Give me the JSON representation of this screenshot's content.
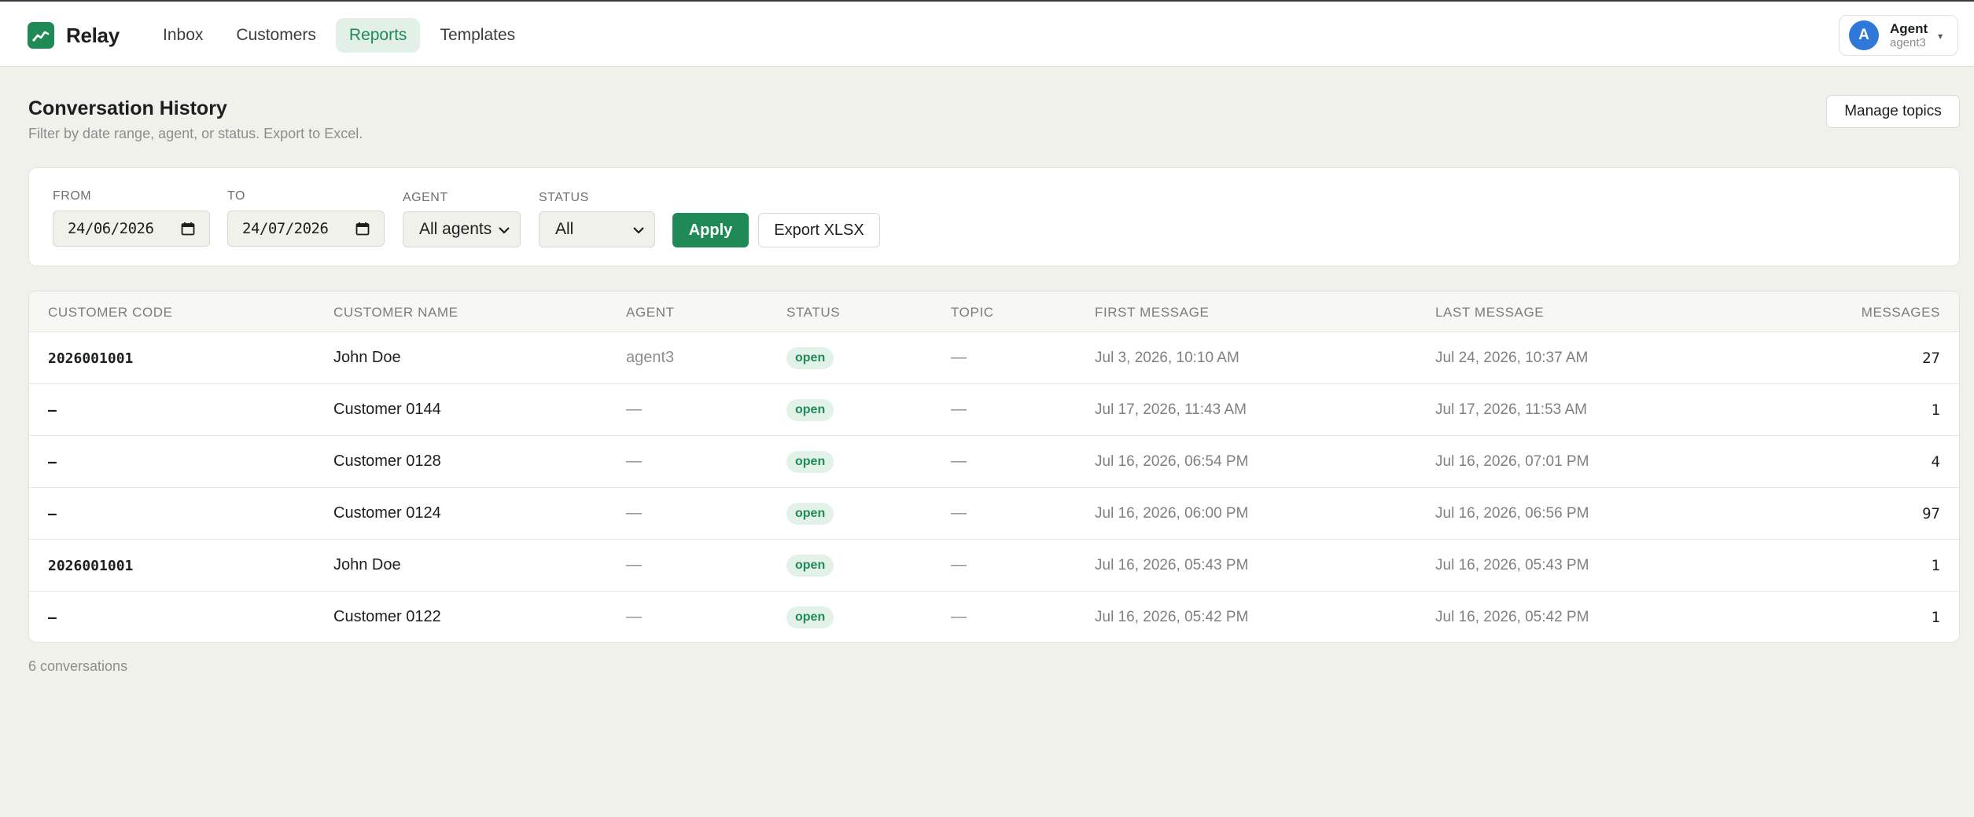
{
  "app": {
    "name": "Relay",
    "nav": [
      {
        "label": "Inbox",
        "active": false
      },
      {
        "label": "Customers",
        "active": false
      },
      {
        "label": "Reports",
        "active": true
      },
      {
        "label": "Templates",
        "active": false
      }
    ],
    "user": {
      "initial": "A",
      "name": "Agent",
      "username": "agent3"
    }
  },
  "page": {
    "title": "Conversation History",
    "subtitle": "Filter by date range, agent, or status. Export to Excel.",
    "manage_topics_label": "Manage topics"
  },
  "filters": {
    "from_label": "FROM",
    "from_value": "24/06/2026",
    "to_label": "TO",
    "to_value": "24/07/2026",
    "agent_label": "AGENT",
    "agent_value": "All agents",
    "status_label": "STATUS",
    "status_value": "All",
    "apply_label": "Apply",
    "export_label": "Export XLSX"
  },
  "table": {
    "headers": {
      "code": "CUSTOMER CODE",
      "name": "CUSTOMER NAME",
      "agent": "AGENT",
      "status": "STATUS",
      "topic": "TOPIC",
      "first": "FIRST MESSAGE",
      "last": "LAST MESSAGE",
      "messages": "MESSAGES"
    },
    "rows": [
      {
        "code": "2026001001",
        "name": "John Doe",
        "agent": "agent3",
        "status": "open",
        "topic": "—",
        "first": "Jul 3, 2026, 10:10 AM",
        "last": "Jul 24, 2026, 10:37 AM",
        "messages": "27"
      },
      {
        "code": "–",
        "name": "Customer 0144",
        "agent": "—",
        "status": "open",
        "topic": "—",
        "first": "Jul 17, 2026, 11:43 AM",
        "last": "Jul 17, 2026, 11:53 AM",
        "messages": "1"
      },
      {
        "code": "–",
        "name": "Customer 0128",
        "agent": "—",
        "status": "open",
        "topic": "—",
        "first": "Jul 16, 2026, 06:54 PM",
        "last": "Jul 16, 2026, 07:01 PM",
        "messages": "4"
      },
      {
        "code": "–",
        "name": "Customer 0124",
        "agent": "—",
        "status": "open",
        "topic": "—",
        "first": "Jul 16, 2026, 06:00 PM",
        "last": "Jul 16, 2026, 06:56 PM",
        "messages": "97"
      },
      {
        "code": "2026001001",
        "name": "John Doe",
        "agent": "—",
        "status": "open",
        "topic": "—",
        "first": "Jul 16, 2026, 05:43 PM",
        "last": "Jul 16, 2026, 05:43 PM",
        "messages": "1"
      },
      {
        "code": "–",
        "name": "Customer 0122",
        "agent": "—",
        "status": "open",
        "topic": "—",
        "first": "Jul 16, 2026, 05:42 PM",
        "last": "Jul 16, 2026, 05:42 PM",
        "messages": "1"
      }
    ]
  },
  "footer": {
    "count_text": "6 conversations"
  },
  "colors": {
    "brand": "#1f8a55",
    "avatar": "#2f77d8",
    "background": "#f1f1ec",
    "badge_bg": "#e3f2e8"
  }
}
